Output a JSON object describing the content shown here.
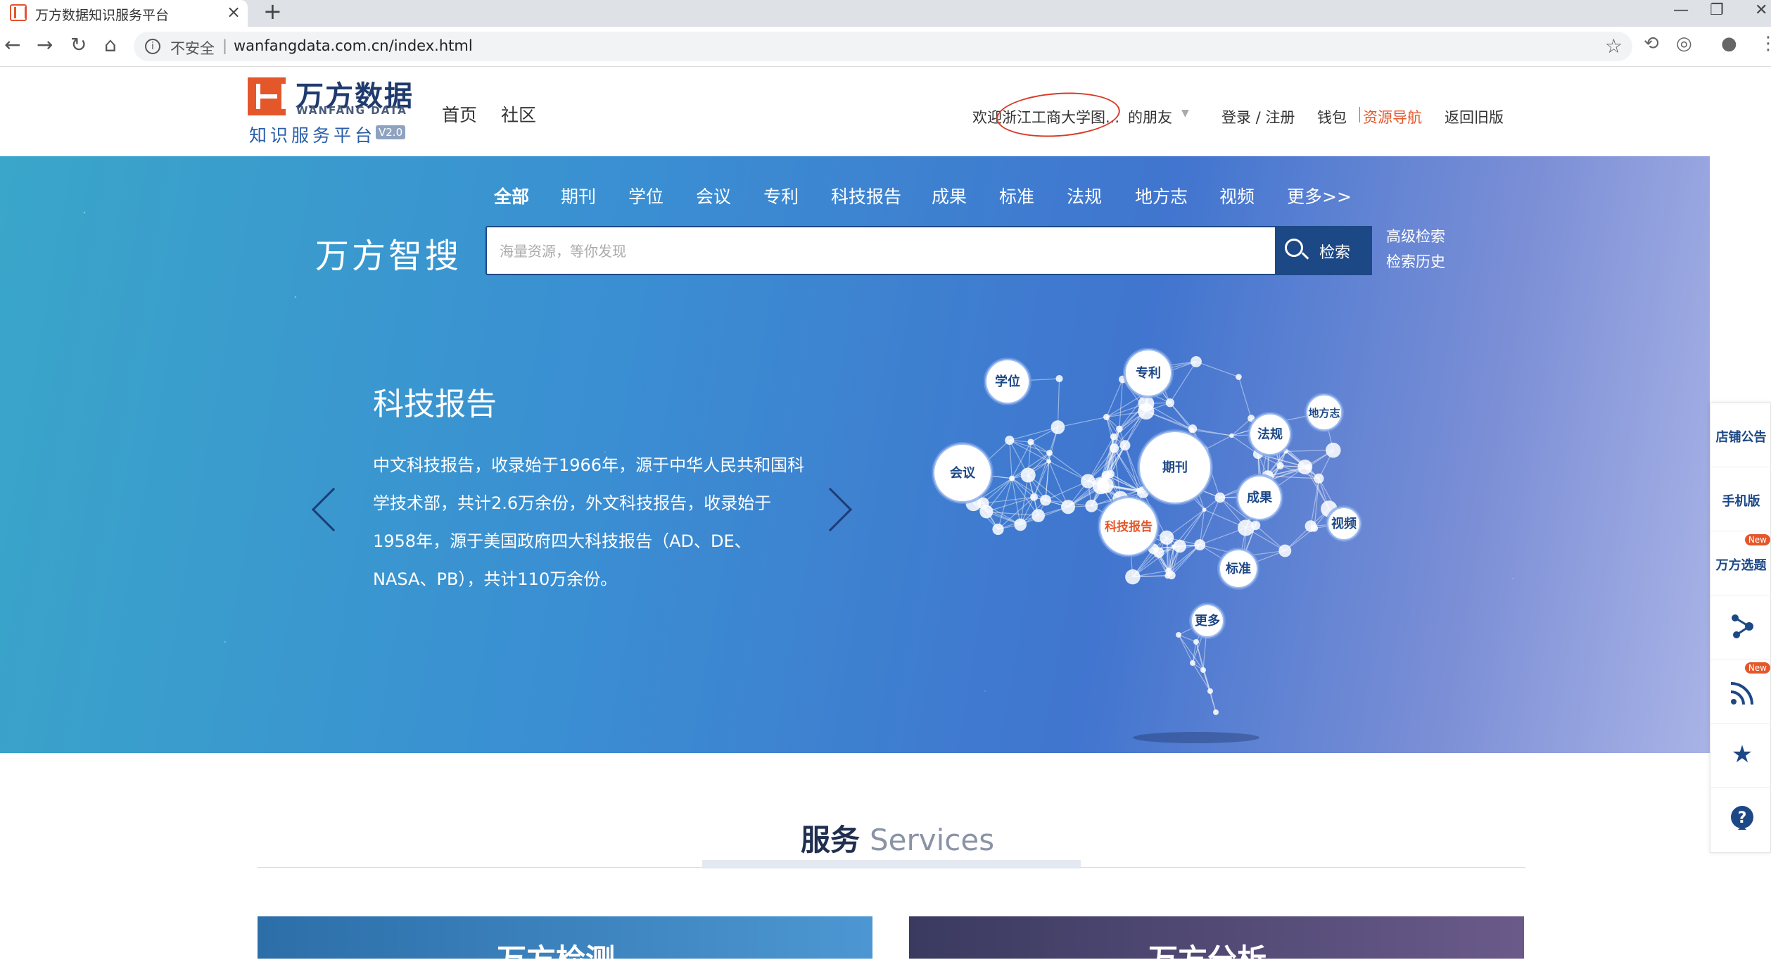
{
  "browser": {
    "tab_title": "万方数据知识服务平台",
    "tab_close": "×",
    "new_tab": "+",
    "back": "←",
    "forward": "→",
    "reload": "↻",
    "home": "⌂",
    "insecure": "不安全",
    "url_sep": "|",
    "url": "wanfangdata.com.cn/index.html",
    "star": "☆"
  },
  "header": {
    "logo_cn": "万方数据",
    "logo_en": "WANFANG DATA",
    "logo_sub": "知识服务平台",
    "logo_version": "V2.0",
    "nav": [
      "首页",
      "社区"
    ],
    "welcome": "欢迎浙江工商大学图...",
    "friend": "的朋友",
    "login": "登录 / 注册",
    "wallet": "钱包",
    "resource_nav": "资源导航",
    "old_version": "返回旧版"
  },
  "search": {
    "categories": [
      "全部",
      "期刊",
      "学位",
      "会议",
      "专利",
      "科技报告",
      "成果",
      "标准",
      "法规",
      "地方志",
      "视频",
      "更多>>"
    ],
    "active_category": "全部",
    "title": "万方智搜",
    "placeholder": "海量资源，等你发现",
    "button": "检索",
    "advanced": "高级检索",
    "history": "检索历史"
  },
  "slide": {
    "title": "科技报告",
    "description": "中文科技报告，收录始于1966年，源于中华人民共和国科学技术部，共计2.6万余份，外文科技报告，收录始于1958年，源于美国政府四大科技报告（AD、DE、NASA、PB），共计110万余份。",
    "brain_nodes": [
      "学位",
      "专利",
      "地方志",
      "法规",
      "会议",
      "期刊",
      "成果",
      "科技报告",
      "视频",
      "标准",
      "更多"
    ],
    "highlight_node": "科技报告",
    "accent_color": "#e4572b"
  },
  "services": {
    "title_cn": "服务",
    "title_en": "Services",
    "cards": [
      "万方检测",
      "万方分析"
    ]
  },
  "side_panel": {
    "store_notice": "店铺公告",
    "mobile": "手机版",
    "topic_select": "万方选题",
    "new_badge": "New"
  }
}
